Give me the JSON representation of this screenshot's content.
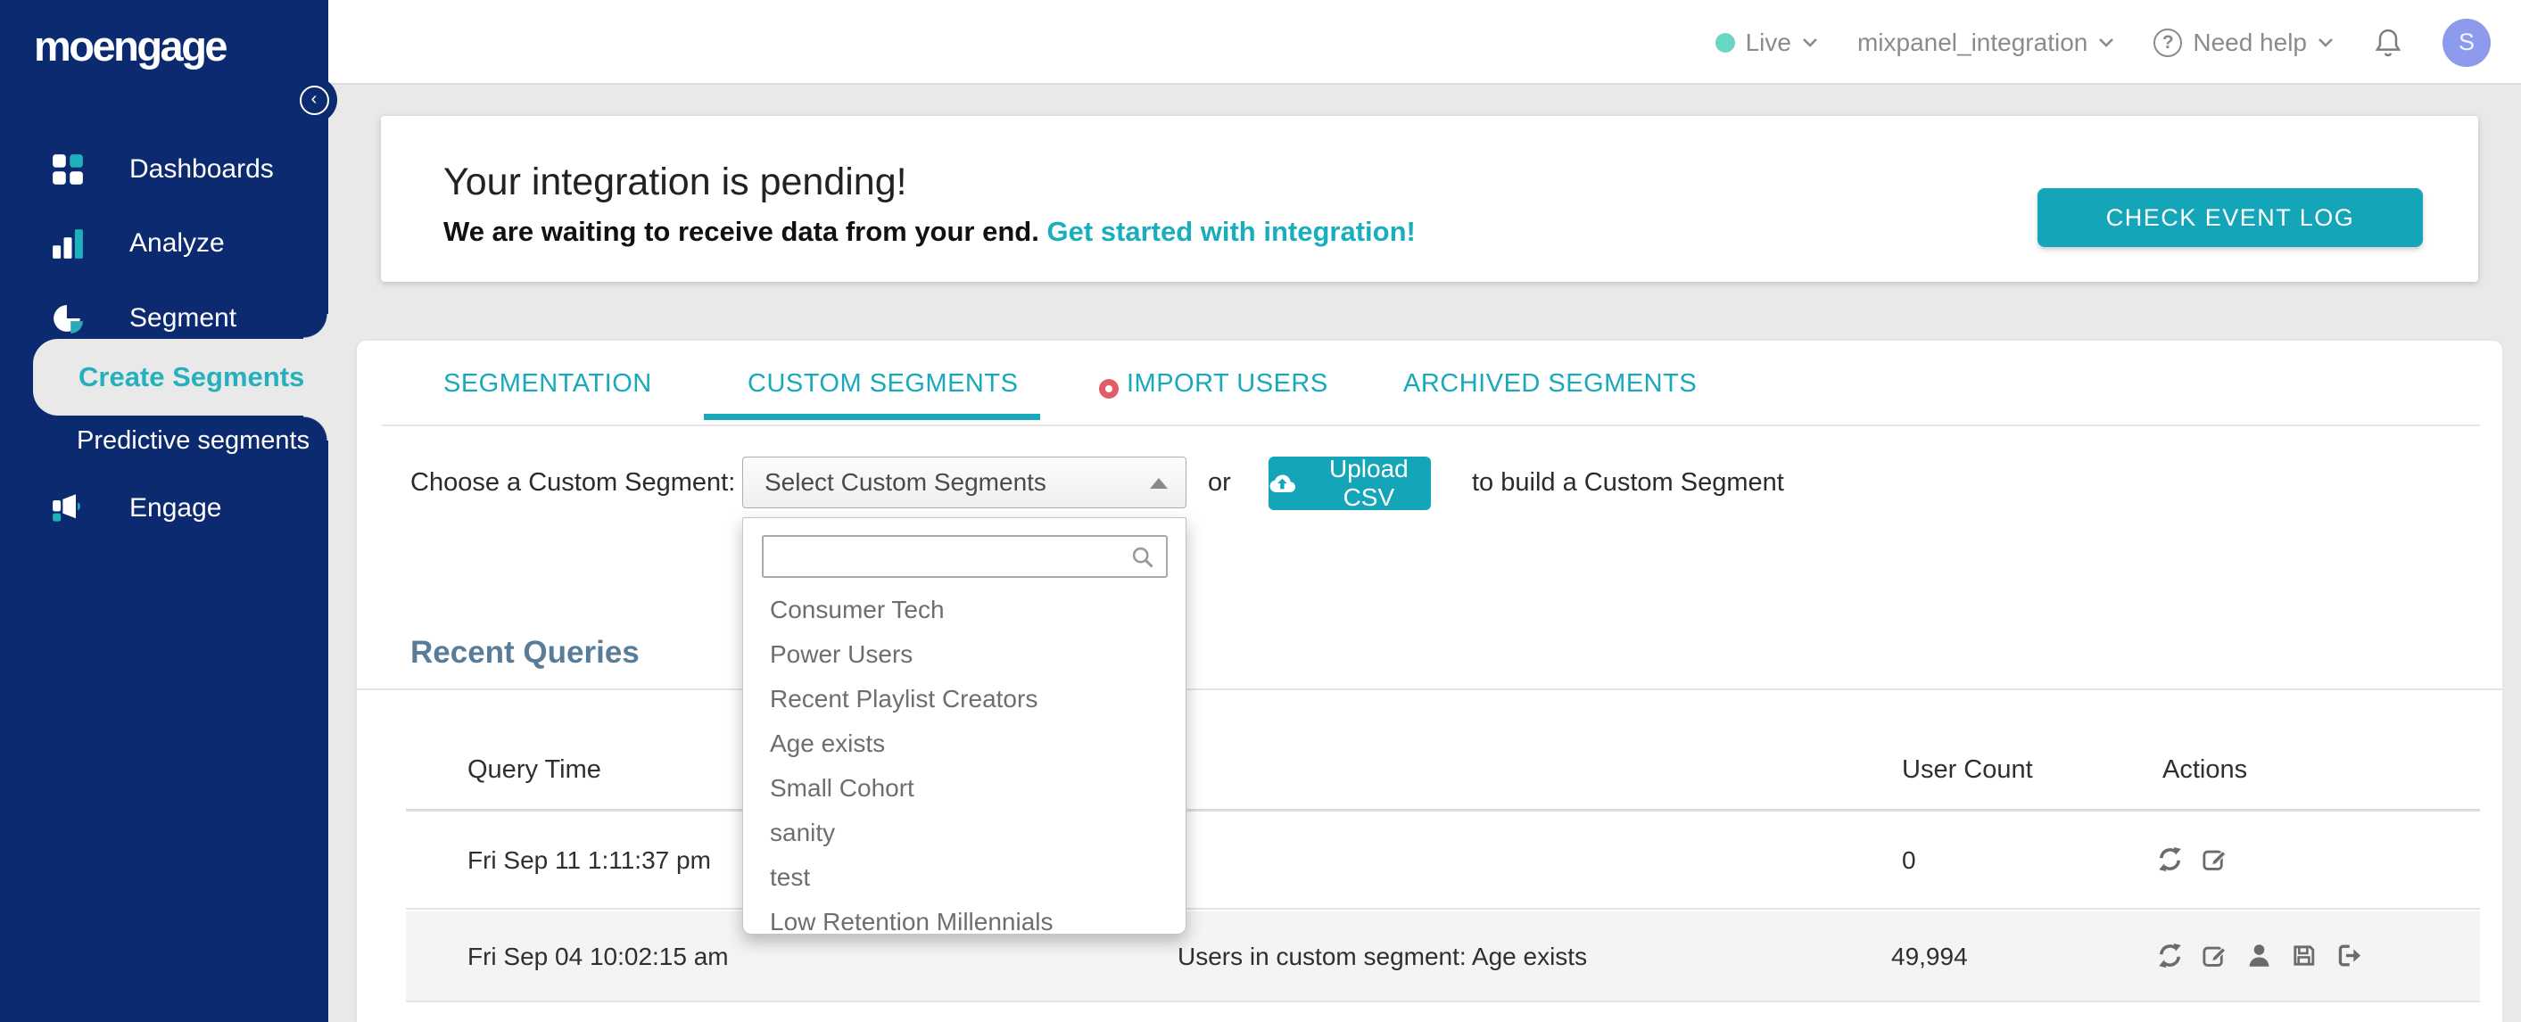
{
  "app": {
    "logo_text": "moengage"
  },
  "topbar": {
    "env_label": "Live",
    "workspace": "mixpanel_integration",
    "help_label": "Need help",
    "avatar_initial": "S",
    "icons": [
      "live-dot",
      "chevron-down-icon",
      "help-circle-icon",
      "bell-icon",
      "avatar"
    ]
  },
  "sidebar": {
    "items": [
      {
        "label": "Dashboards",
        "icon": "grid-icon"
      },
      {
        "label": "Analyze",
        "icon": "bar-chart-icon"
      },
      {
        "label": "Segment",
        "icon": "pie-chart-icon"
      },
      {
        "label": "Create Segments",
        "active": true
      },
      {
        "label": "Predictive segments"
      },
      {
        "label": "Engage",
        "icon": "megaphone-icon"
      }
    ],
    "collapse_icon": "chevron-left-icon"
  },
  "banner": {
    "title": "Your integration is pending!",
    "subtitle": "We are waiting to receive data from your end.",
    "link_text": "Get started with integration!",
    "button_label": "CHECK EVENT LOG"
  },
  "tabs": {
    "items": [
      {
        "label": "SEGMENTATION"
      },
      {
        "label": "CUSTOM SEGMENTS",
        "active": true
      },
      {
        "label": "IMPORT USERS",
        "has_badge": true,
        "badge_icon": "red-dot-icon"
      },
      {
        "label": "ARCHIVED SEGMENTS"
      }
    ]
  },
  "chooser": {
    "label": "Choose a Custom Segment:",
    "select_value": "Select Custom Segments",
    "search_value": "",
    "or_text": "or",
    "upload_label": "Upload CSV",
    "upload_icon": "cloud-upload-icon",
    "suffix_text": "to build a Custom Segment",
    "options": [
      "Consumer Tech",
      "Power Users",
      "Recent Playlist Creators",
      "Age exists",
      "Small Cohort",
      "sanity",
      "test",
      "Low Retention Millennials"
    ]
  },
  "recent_queries": {
    "heading": "Recent Queries",
    "columns": {
      "time": "Query Time",
      "count": "User Count",
      "actions": "Actions"
    },
    "rows": [
      {
        "time": "Fri Sep 11 1:11:37 pm",
        "count": "0",
        "action_icons": [
          "refresh",
          "edit"
        ]
      },
      {
        "time": "Fri Sep 04 10:02:15 am",
        "query": "Users in custom segment: Age exists",
        "count": "49,994",
        "action_icons": [
          "refresh",
          "edit",
          "user",
          "save",
          "export"
        ]
      }
    ]
  },
  "colors": {
    "accent_teal": "#14a6b8",
    "navy": "#0b2a70",
    "live_dot": "#69d5c5",
    "heading_slate": "#597d99",
    "badge_red": "#e05c66",
    "avatar_purple": "#8e9aec"
  }
}
